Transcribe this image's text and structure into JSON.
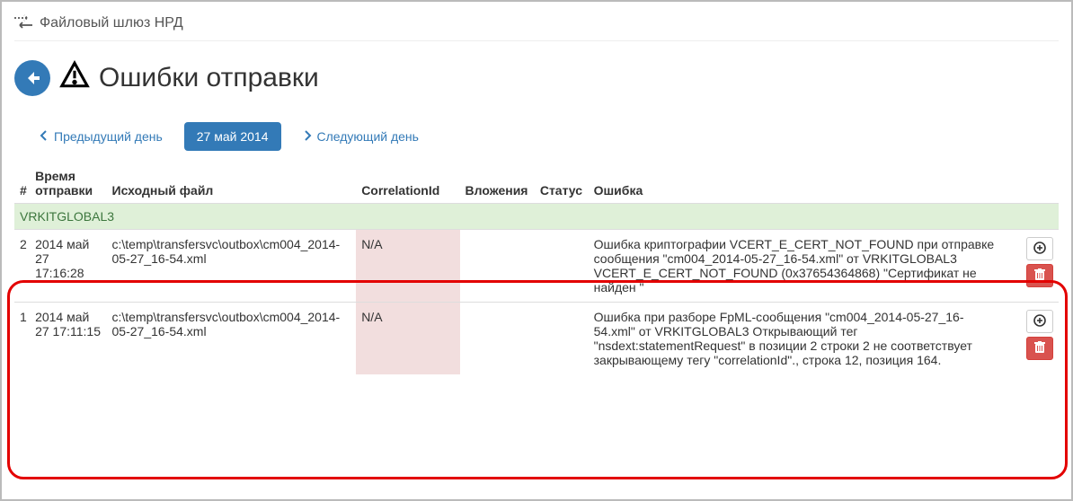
{
  "app": {
    "title": "Файловый шлюз НРД"
  },
  "page": {
    "title": "Ошибки отправки"
  },
  "nav": {
    "prev": "Предыдущий день",
    "date": "27 май 2014",
    "next": "Следующий день"
  },
  "columns": {
    "num": "#",
    "time": "Время отправки",
    "file": "Исходный файл",
    "corr": "CorrelationId",
    "att": "Вложения",
    "status": "Статус",
    "err": "Ошибка"
  },
  "group": "VRKITGLOBAL3",
  "rows": [
    {
      "num": "2",
      "time": "2014 май 27 17:16:28",
      "file": "c:\\temp\\transfersvc\\outbox\\cm004_2014-05-27_16-54.xml",
      "corr": "N/A",
      "att": "",
      "status": "",
      "err": "Ошибка криптографии VCERT_E_CERT_NOT_FOUND при отправке сообщения \"cm004_2014-05-27_16-54.xml\" от VRKITGLOBAL3 VCERT_E_CERT_NOT_FOUND (0x37654364868) \"Сертификат не найден \""
    },
    {
      "num": "1",
      "time": "2014 май 27 17:11:15",
      "file": "c:\\temp\\transfersvc\\outbox\\cm004_2014-05-27_16-54.xml",
      "corr": "N/A",
      "att": "",
      "status": "",
      "err": "Ошибка при разборе FpML-сообщения \"cm004_2014-05-27_16-54.xml\" от VRKITGLOBAL3 Открывающий тег \"nsdext:statementRequest\" в позиции 2 строки 2 не соответствует закрывающему тегу \"correlationId\"., строка 12, позиция 164."
    }
  ]
}
